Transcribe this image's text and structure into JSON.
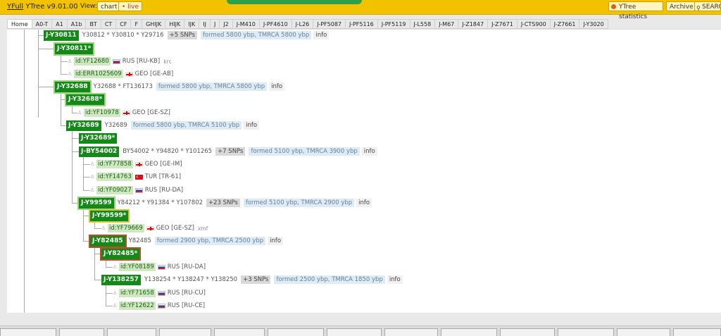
{
  "header": {
    "brand": "YFull",
    "version": "YTree v9.01.00",
    "view_label": "View:",
    "chart_label": "chart",
    "live_label": "• live",
    "stats_label": "YTree statistics",
    "archive_label": "Archive",
    "search_label": "SEARCH"
  },
  "tabs": [
    "Home",
    "A0-T",
    "A1",
    "A1b",
    "BT",
    "CT",
    "CF",
    "F",
    "GHIJK",
    "HIJK",
    "IJK",
    "IJ",
    "J",
    "J2",
    "J-M410",
    "J-PF4610",
    "J-L26",
    "J-PF5087",
    "J-PF5116",
    "J-PF5119",
    "J-L558",
    "J-M67",
    "J-Z1847",
    "J-Z7671",
    "J-CTS900",
    "J-Z7661",
    "J-Y3020"
  ],
  "tree": {
    "y30811": {
      "name": "J-Y30811",
      "snps": "Y30812 * Y30810 * Y29716",
      "count": "+5 SNPs",
      "age": "formed 5800 ybp, TMRCA 5800 ybp",
      "info": "info"
    },
    "y30811s": {
      "name": "J-Y30811*"
    },
    "yf12680": {
      "id": "id:YF12680",
      "region": "RUS [RU-KB]",
      "extra": "krc"
    },
    "err1025609": {
      "id": "id:ERR1025609",
      "region": "GEO [GE-AB]"
    },
    "y32688": {
      "name": "J-Y32688",
      "snps": "Y32688 * FT136173",
      "age": "formed 5800 ybp, TMRCA 5800 ybp",
      "info": "info"
    },
    "y32688s": {
      "name": "J-Y32688*"
    },
    "yf10978": {
      "id": "id:YF10978",
      "region": "GEO [GE-SZ]"
    },
    "y32689": {
      "name": "J-Y32689",
      "snps": "Y32689",
      "age": "formed 5800 ybp, TMRCA 5100 ybp",
      "info": "info"
    },
    "y32689s": {
      "name": "J-Y32689*"
    },
    "by54002": {
      "name": "J-BY54002",
      "snps": "BY54002 * Y94820 * Y101265",
      "count": "+7 SNPs",
      "age": "formed 5100 ybp, TMRCA 3900 ybp",
      "info": "info"
    },
    "yf77858": {
      "id": "id:YF77858",
      "region": "GEO [GE-IM]"
    },
    "yf14763": {
      "id": "id:YF14763",
      "region": "TUR [TR-61]"
    },
    "yf09027": {
      "id": "id:YF09027",
      "region": "RUS [RU-DA]"
    },
    "y99599": {
      "name": "J-Y99599",
      "snps": "Y84212 * Y91384 * Y107802",
      "count": "+23 SNPs",
      "age": "formed 5100 ybp, TMRCA 2900 ybp",
      "info": "info"
    },
    "y99599s": {
      "name": "J-Y99599*"
    },
    "yf79669": {
      "id": "id:YF79669",
      "region": "GEO [GE-SZ]",
      "extra": "xmf"
    },
    "y82485": {
      "name": "J-Y82485",
      "snps": "Y82485",
      "age": "formed 2900 ybp, TMRCA 2500 ybp",
      "info": "info"
    },
    "y82485s": {
      "name": "J-Y82485*"
    },
    "yf08189": {
      "id": "id:YF08189",
      "region": "RUS [RU-DA]"
    },
    "y138257": {
      "name": "J-Y138257",
      "snps": "Y138254 * Y138247 * Y138250",
      "count": "+3 SNPs",
      "age": "formed 2500 ybp, TMRCA 1850 ybp",
      "info": "info"
    },
    "yf71658": {
      "id": "id:YF71658",
      "region": "RUS [RU-CU]"
    },
    "yf12622": {
      "id": "id:YF12622",
      "region": "RUS [RU-CE]"
    }
  }
}
